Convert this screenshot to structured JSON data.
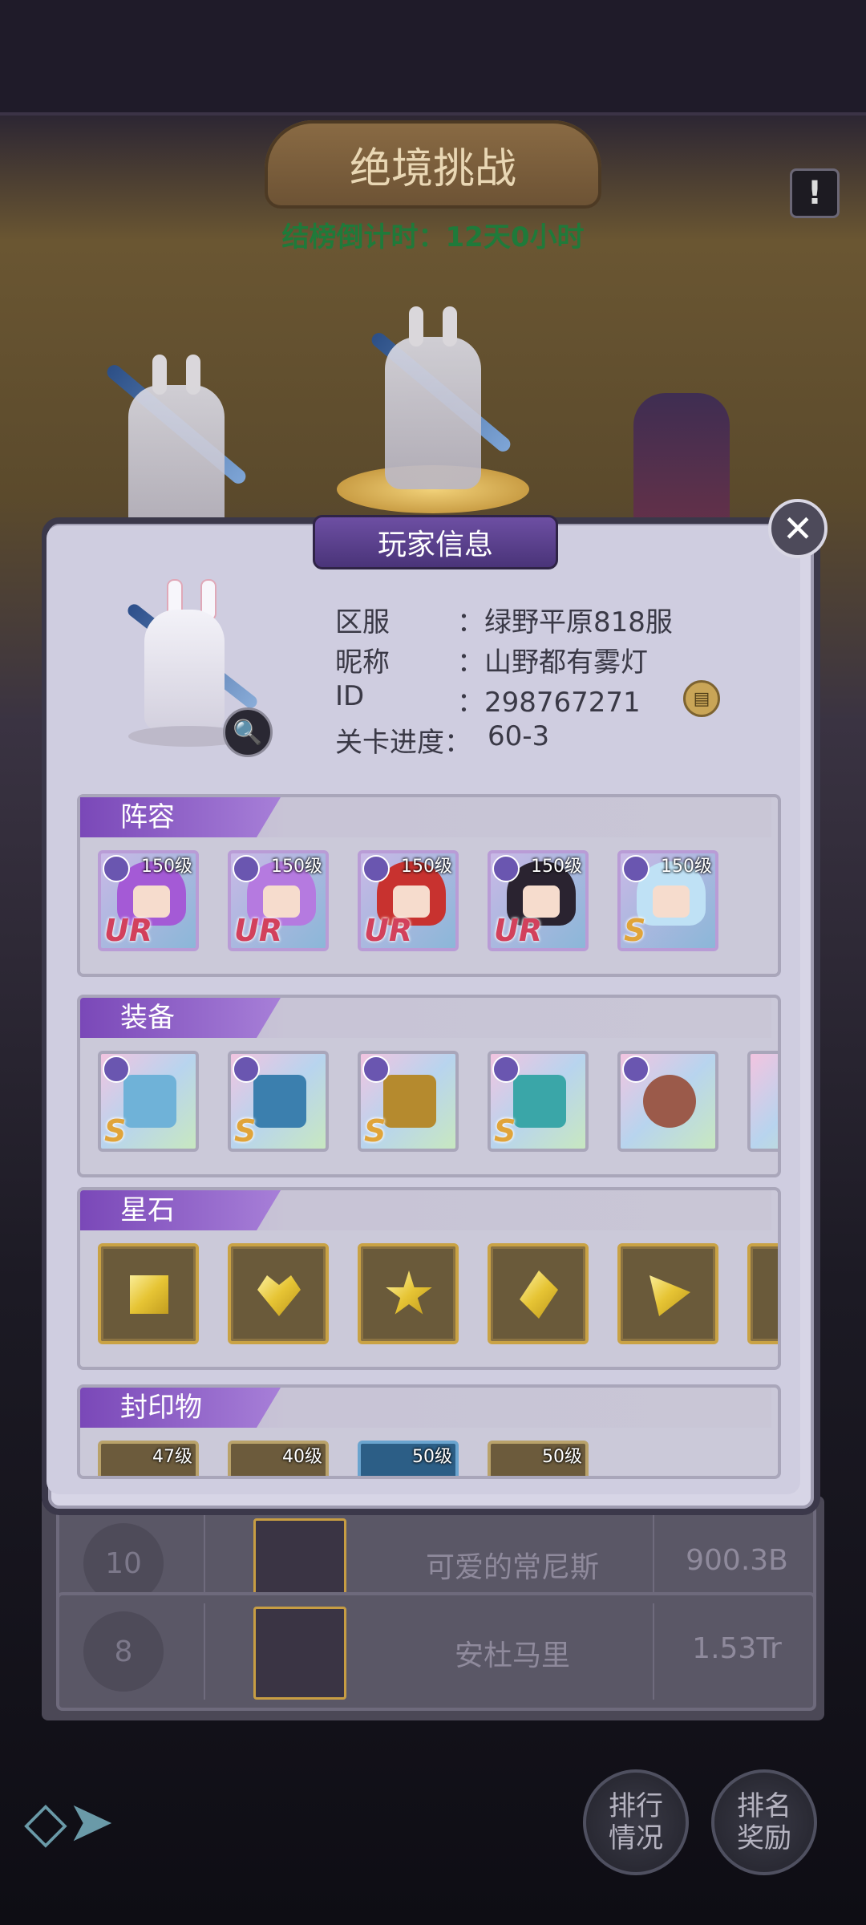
{
  "header": {
    "title": "绝境挑战",
    "countdown": "结榜倒计时：12天0小时"
  },
  "modal": {
    "title": "玩家信息",
    "info": [
      {
        "label": "区服",
        "value": "：绿野平原818服"
      },
      {
        "label": "昵称",
        "value": "：山野都有雾灯"
      },
      {
        "label": "ID",
        "value": "：298767271"
      },
      {
        "label": "关卡进度：",
        "value": "60-3"
      }
    ],
    "sections": {
      "lineup": {
        "title": "阵容",
        "heroes": [
          {
            "level": "150级",
            "rarity": "UR",
            "hair": "#a45ad6"
          },
          {
            "level": "150级",
            "rarity": "UR",
            "hair": "#b57ae0"
          },
          {
            "level": "150级",
            "rarity": "UR",
            "hair": "#c8322f"
          },
          {
            "level": "150级",
            "rarity": "UR",
            "hair": "#2a2330"
          },
          {
            "level": "150级",
            "rarity": "S",
            "hair": "#bfe1f5"
          }
        ]
      },
      "equipment": {
        "title": "装备",
        "items": [
          {
            "rarity": "S",
            "icon": "trident-icon"
          },
          {
            "rarity": "S",
            "icon": "book-icon"
          },
          {
            "rarity": "S",
            "icon": "helmet-icon"
          },
          {
            "rarity": "S",
            "icon": "armor-icon"
          },
          {
            "rarity": "",
            "icon": "bracelet-icon"
          }
        ]
      },
      "starstones": {
        "title": "星石",
        "items": [
          {
            "icon": "square-gem-icon"
          },
          {
            "icon": "heart-gem-icon"
          },
          {
            "icon": "star-gem-icon"
          },
          {
            "icon": "diamond-gem-icon"
          },
          {
            "icon": "triangle-gem-icon"
          }
        ]
      },
      "seals": {
        "title": "封印物",
        "items": [
          {
            "level": "47级"
          },
          {
            "level": "40级"
          },
          {
            "level": "50级"
          },
          {
            "level": "50级"
          }
        ]
      }
    }
  },
  "ranking": {
    "rows": [
      {
        "rank": "10",
        "name": "可爱的常尼斯",
        "score": "900.3B"
      },
      {
        "rank": "8",
        "name": "安杜马里",
        "score": "1.53Tr"
      }
    ]
  },
  "nav": {
    "ranking_label": "排行\n情况",
    "reward_label": "排名\n奖励"
  }
}
